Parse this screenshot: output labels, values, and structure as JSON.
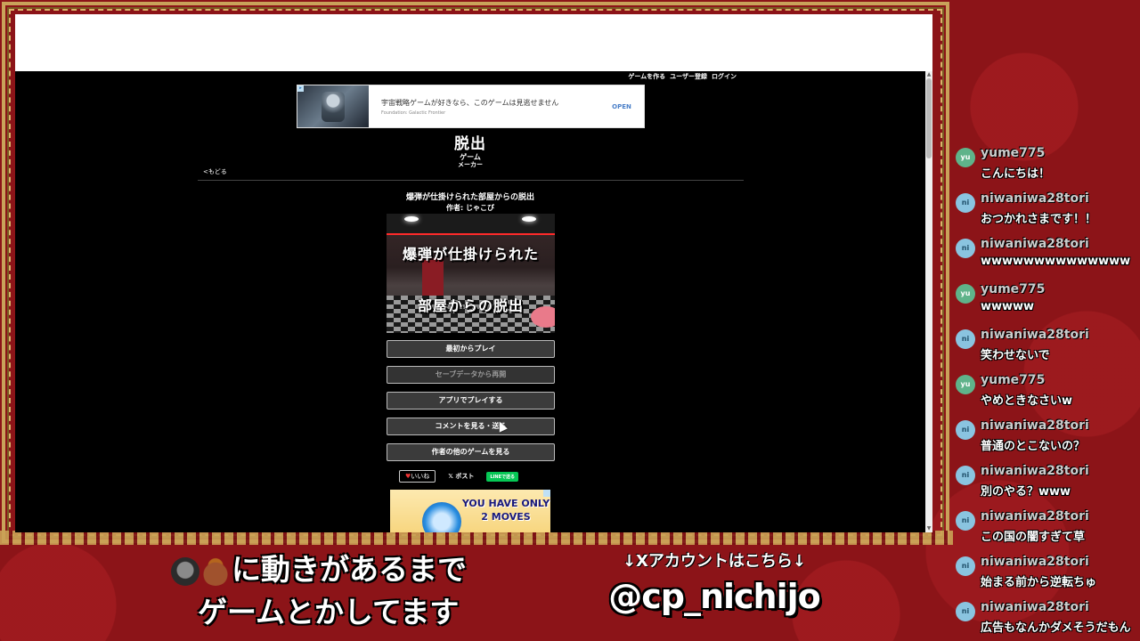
{
  "browser": {
    "top_nav": [
      "ゲームを作る",
      "ユーザー登録",
      "ログイン"
    ],
    "ad": {
      "title": "宇宙戦略ゲームが好きなら、このゲームは見逃せません",
      "advertiser": "Foundation: Galactic Frontier",
      "cta": "OPEN"
    },
    "logo": {
      "main": "脱出",
      "sub": "ゲーム",
      "sub2": "メーカー"
    },
    "back_link": "<もどる",
    "game": {
      "title": "爆弾が仕掛けられた部屋からの脱出",
      "author": "作者: じゃこび",
      "thumb_line1": "爆弾が仕掛けられた",
      "thumb_line2": "部屋からの脱出"
    },
    "buttons": [
      {
        "label": "最初からプレイ",
        "enabled": true
      },
      {
        "label": "セーブデータから再開",
        "enabled": false
      },
      {
        "label": "アプリでプレイする",
        "enabled": true
      },
      {
        "label": "コメントを見る・送る",
        "enabled": true
      },
      {
        "label": "作者の他のゲームを見る",
        "enabled": true
      }
    ],
    "social": {
      "like": "いいね",
      "post": "ポスト",
      "line": "LINEで送る"
    },
    "ad_bottom": {
      "line1": "YOU HAVE ONLY",
      "line2": "2 MOVES"
    }
  },
  "overlay": {
    "left_line1": "に動きがあるまで",
    "left_line2": "ゲームとかしてます",
    "right_note": "↓Xアカウントはこちら↓",
    "right_handle": "@cp_nichijo"
  },
  "chat": [
    {
      "avatar": "yu",
      "user": "yume775",
      "text": "こんにちは！"
    },
    {
      "avatar": "ni",
      "user": "niwaniwa28tori",
      "text": "おつかれさまです！！"
    },
    {
      "avatar": "ni",
      "user": "niwaniwa28tori",
      "text": "wwwwwwwwwwwwww"
    },
    {
      "avatar": "yu",
      "user": "yume775",
      "text": "wwwww"
    },
    {
      "avatar": "ni",
      "user": "niwaniwa28tori",
      "text": "笑わせないで"
    },
    {
      "avatar": "yu",
      "user": "yume775",
      "text": "やめときなさいw"
    },
    {
      "avatar": "ni",
      "user": "niwaniwa28tori",
      "text": "普通のとこないの？"
    },
    {
      "avatar": "ni",
      "user": "niwaniwa28tori",
      "text": "別のやる？www"
    },
    {
      "avatar": "ni",
      "user": "niwaniwa28tori",
      "text": "この国の闇すぎて草"
    },
    {
      "avatar": "ni",
      "user": "niwaniwa28tori",
      "text": "始まる前から逆転ちゅ"
    },
    {
      "avatar": "ni",
      "user": "niwaniwa28tori",
      "text": "広告もなんかダメそうだもん"
    }
  ]
}
